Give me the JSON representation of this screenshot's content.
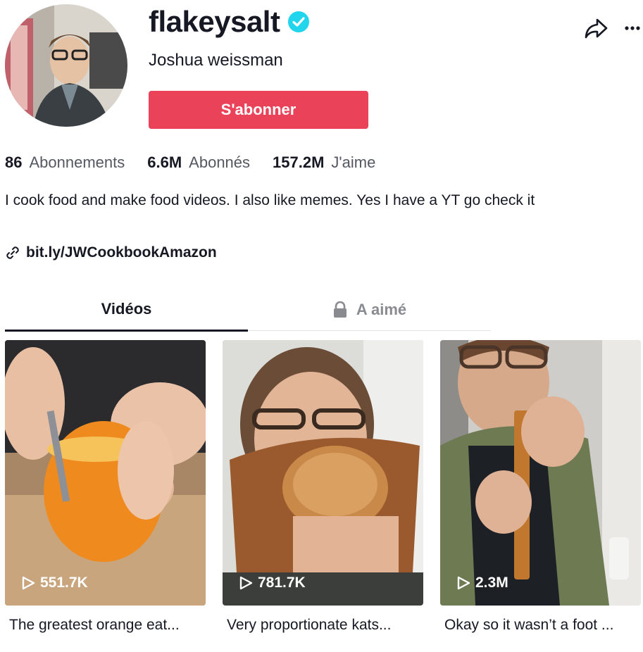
{
  "profile": {
    "username": "flakeysalt",
    "display_name": "Joshua weissman",
    "subscribe_label": "S'abonner",
    "verified_icon": "verified-check-icon",
    "accent_color": "#ea4359"
  },
  "stats": [
    {
      "value": "86",
      "label": "Abonnements"
    },
    {
      "value": "6.6M",
      "label": "Abonnés"
    },
    {
      "value": "157.2M",
      "label": "J'aime"
    }
  ],
  "bio": "I cook food and make food videos. I also like memes. Yes I have a YT go check it",
  "link": "bit.ly/JWCookbookAmazon",
  "tabs": {
    "videos": "Vidéos",
    "liked": "A aimé"
  },
  "videos": [
    {
      "views": "551.7K",
      "caption": "The greatest orange eat..."
    },
    {
      "views": "781.7K",
      "caption": "Very proportionate kats..."
    },
    {
      "views": "2.3M",
      "caption": "Okay so it wasn’t a foot ..."
    }
  ]
}
